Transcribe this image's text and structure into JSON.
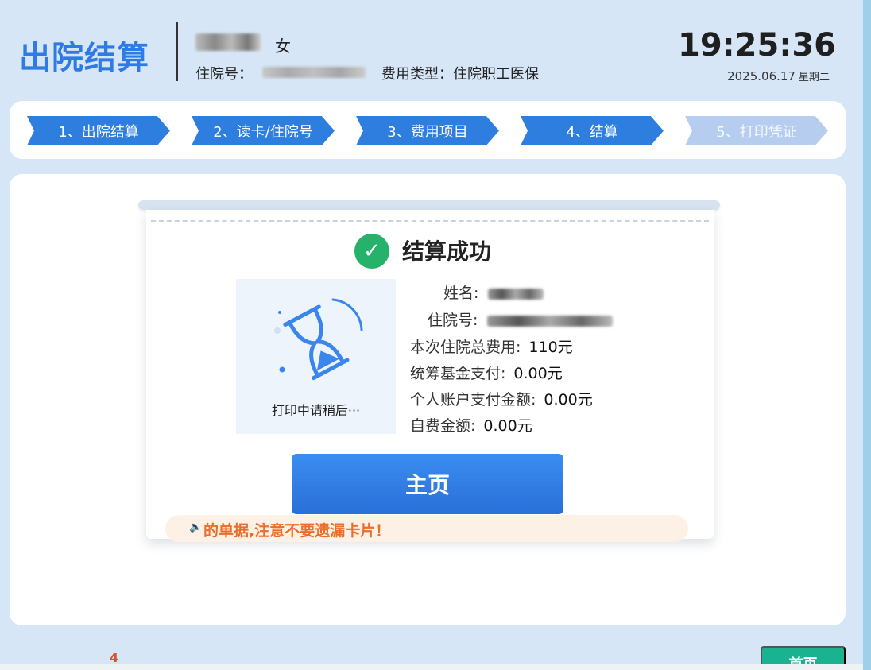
{
  "header": {
    "title": "出院结算",
    "gender": "女",
    "admission_label": "住院号：",
    "fee_type": "费用类型：住院职工医保",
    "time": "19:25:36",
    "date": "2025.06.17",
    "weekday": "星期二"
  },
  "steps": [
    {
      "label": "1、出院结算",
      "state": "done"
    },
    {
      "label": "2、读卡/住院号",
      "state": "done"
    },
    {
      "label": "3、费用项目",
      "state": "done"
    },
    {
      "label": "4、结算",
      "state": "current"
    },
    {
      "label": "5、打印凭证",
      "state": "pending"
    }
  ],
  "result": {
    "title": "结算成功",
    "printing_message": "打印中请稍后···",
    "fields": {
      "name_label": "姓名:",
      "admission_label": "住院号:",
      "total_label": "本次住院总费用:",
      "total_value": "110元",
      "fund_label": "统筹基金支付:",
      "fund_value": "0.00元",
      "personal_label": "个人账户支付金额:",
      "personal_value": "0.00元",
      "self_label": "自费金额:",
      "self_value": "0.00元"
    }
  },
  "actions": {
    "home_label": "主页"
  },
  "notice": {
    "text": "的单据,注意不要遗漏卡片！"
  },
  "footer": {
    "button_label": "首页",
    "red_glyph": "4"
  },
  "colors": {
    "accent": "#2e7ee0",
    "success": "#27b26b",
    "warning": "#ea6d2b",
    "background": "#d6e6f7"
  }
}
